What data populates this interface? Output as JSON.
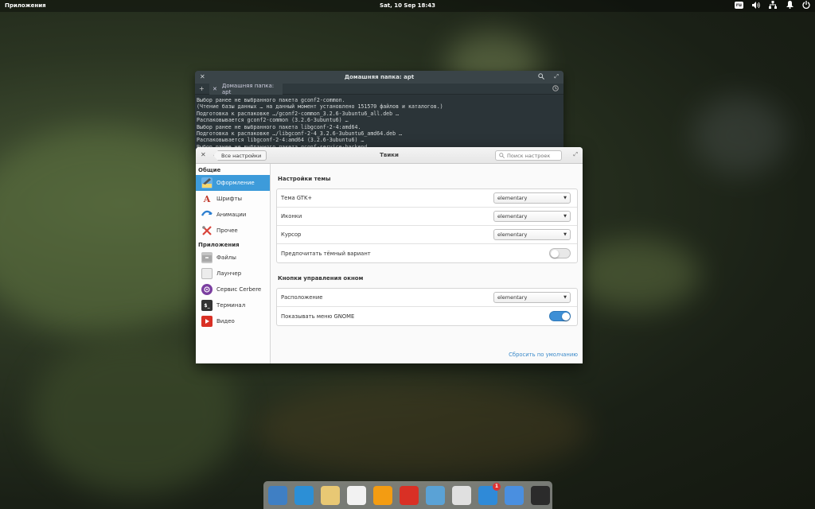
{
  "top_panel": {
    "applications_label": "Приложения",
    "clock": "Sat, 10 Sep    18:43",
    "keyboard_layout": "ru",
    "indicators": [
      "volume-icon",
      "network-icon",
      "notification-bell-icon",
      "power-icon"
    ]
  },
  "terminal": {
    "title": "Домашняя папка: apt",
    "tab_label": "Домашняя папка: apt",
    "lines": [
      "Выбор ранее не выбранного пакета gconf2-common.",
      "(Чтение базы данных … на данный момент установлено 151570 файлов и каталогов.)",
      "Подготовка к распаковке …/gconf2-common_3.2.6-3ubuntu6_all.deb …",
      "Распаковывается gconf2-common (3.2.6-3ubuntu6) …",
      "Выбор ранее не выбранного пакета libgconf-2-4:amd64.",
      "Подготовка к распаковке …/libgconf-2-4_3.2.6-3ubuntu6_amd64.deb …",
      "Распаковывается libgconf-2-4:amd64 (3.2.6-3ubuntu6) …",
      "Выбор ранее не выбранного пакета gconf-service-backend"
    ]
  },
  "tweaks": {
    "back_label": "Все настройки",
    "title": "Твики",
    "search_placeholder": "Поиск настроек",
    "sidebar": {
      "category_general": "Общие",
      "general_items": [
        {
          "label": "Оформление",
          "icon": "appearance-icon",
          "color": "#3d9bda"
        },
        {
          "label": "Шрифты",
          "icon": "fonts-icon",
          "color": "#c0392b"
        },
        {
          "label": "Анимации",
          "icon": "animations-icon",
          "color": "#2d7fd0"
        },
        {
          "label": "Прочее",
          "icon": "misc-icon",
          "color": "#d9443a"
        }
      ],
      "category_apps": "Приложения",
      "app_items": [
        {
          "label": "Файлы",
          "icon": "files-icon",
          "color": "#b9b9b9"
        },
        {
          "label": "Лаунчер",
          "icon": "launcher-icon",
          "color": "#e6e6e6"
        },
        {
          "label": "Сервис Cerbere",
          "icon": "cerbere-icon",
          "color": "#7b3fa0"
        },
        {
          "label": "Терминал",
          "icon": "terminal-icon",
          "color": "#333333"
        },
        {
          "label": "Видео",
          "icon": "video-icon",
          "color": "#d93025"
        }
      ]
    },
    "theme_section": {
      "title": "Настройки темы",
      "gtk_label": "Тема GTK+",
      "gtk_value": "elementary",
      "icons_label": "Иконки",
      "icons_value": "elementary",
      "cursor_label": "Курсор",
      "cursor_value": "elementary",
      "dark_label": "Предпочитать тёмный вариант",
      "dark_on": false
    },
    "window_buttons_section": {
      "title": "Кнопки управления окном",
      "layout_label": "Расположение",
      "layout_value": "elementary",
      "gnome_menu_label": "Показывать меню GNOME",
      "gnome_menu_on": true
    },
    "reset_label": "Сбросить по умолчанию"
  },
  "dock": {
    "apps": [
      {
        "name": "multitasking-view-icon",
        "color": "#3f7fc4"
      },
      {
        "name": "browser-icon",
        "color": "#2c8fd6"
      },
      {
        "name": "mail-icon",
        "color": "#e8c874"
      },
      {
        "name": "calendar-icon",
        "color": "#f2f2f2"
      },
      {
        "name": "music-icon",
        "color": "#f39c12"
      },
      {
        "name": "videos-icon",
        "color": "#d93025"
      },
      {
        "name": "photos-icon",
        "color": "#5aa2d6"
      },
      {
        "name": "settings-toggle-icon",
        "color": "#e0e0e0"
      },
      {
        "name": "appcenter-icon",
        "color": "#2f8ad8",
        "badge": "1"
      },
      {
        "name": "chromium-icon",
        "color": "#4a8fe0"
      },
      {
        "name": "terminal-icon",
        "color": "#2b2b2b"
      }
    ]
  }
}
